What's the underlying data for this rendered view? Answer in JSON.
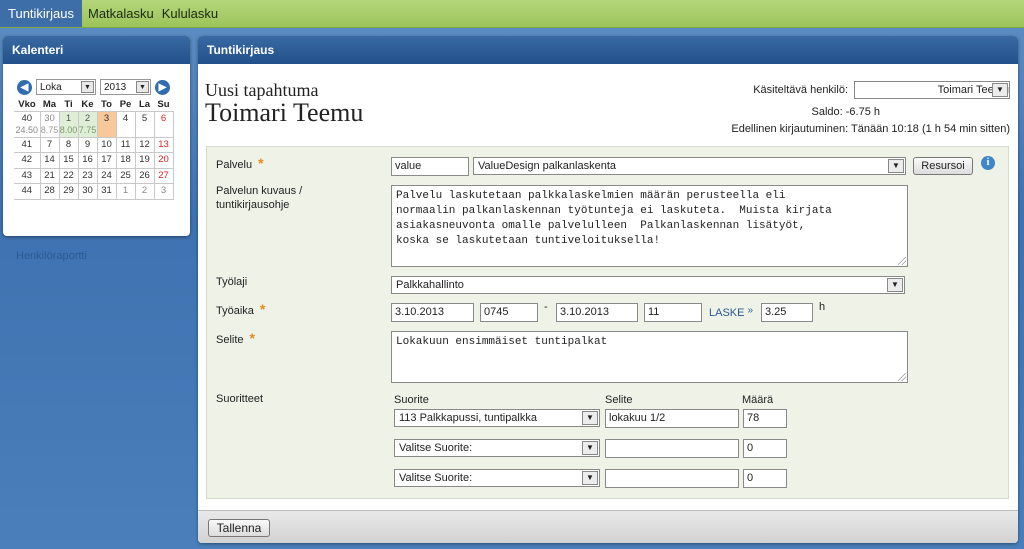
{
  "topnav": {
    "tabs": [
      {
        "label": "Tuntikirjaus",
        "active": true
      },
      {
        "label": "Matkalasku",
        "active": false
      },
      {
        "label": "Kululasku",
        "active": false
      }
    ]
  },
  "calendar": {
    "title": "Kalenteri",
    "month": "Loka",
    "year": "2013",
    "headers": [
      "Vko",
      "Ma",
      "Ti",
      "Ke",
      "To",
      "Pe",
      "La",
      "Su"
    ],
    "weeks": [
      {
        "wk": "40",
        "wk_sub": "24.50",
        "days": [
          {
            "d": "30",
            "sub": "8.75",
            "cls": "grey"
          },
          {
            "d": "1",
            "sub": "8.00",
            "cls": "green"
          },
          {
            "d": "2",
            "sub": "7.75",
            "cls": "green"
          },
          {
            "d": "3",
            "sub": "",
            "cls": "orange"
          },
          {
            "d": "4",
            "sub": "",
            "cls": ""
          },
          {
            "d": "5",
            "sub": "",
            "cls": ""
          },
          {
            "d": "6",
            "sub": "",
            "cls": "sun"
          }
        ]
      },
      {
        "wk": "41",
        "days": [
          {
            "d": "7"
          },
          {
            "d": "8"
          },
          {
            "d": "9"
          },
          {
            "d": "10"
          },
          {
            "d": "11"
          },
          {
            "d": "12"
          },
          {
            "d": "13",
            "cls": "sun"
          }
        ]
      },
      {
        "wk": "42",
        "days": [
          {
            "d": "14"
          },
          {
            "d": "15"
          },
          {
            "d": "16"
          },
          {
            "d": "17"
          },
          {
            "d": "18"
          },
          {
            "d": "19"
          },
          {
            "d": "20",
            "cls": "sun"
          }
        ]
      },
      {
        "wk": "43",
        "days": [
          {
            "d": "21"
          },
          {
            "d": "22"
          },
          {
            "d": "23"
          },
          {
            "d": "24"
          },
          {
            "d": "25"
          },
          {
            "d": "26"
          },
          {
            "d": "27",
            "cls": "sun"
          }
        ]
      },
      {
        "wk": "44",
        "days": [
          {
            "d": "28"
          },
          {
            "d": "29"
          },
          {
            "d": "30"
          },
          {
            "d": "31"
          },
          {
            "d": "1",
            "cls": "grey"
          },
          {
            "d": "2",
            "cls": "grey sun"
          },
          {
            "d": "3",
            "cls": "grey sun"
          }
        ]
      }
    ],
    "report_link": "Henkilöraportti"
  },
  "main": {
    "title": "Tuntikirjaus",
    "heading_small": "Uusi tapahtuma",
    "heading_large": "Toimari Teemu",
    "person_label": "Käsiteltävä henkilö:",
    "person_value": "Toimari Teemu",
    "saldo": "Saldo: -6.75 h",
    "last_login": "Edellinen kirjautuminen: Tänään 10:18 (1 h 54 min sitten)"
  },
  "form": {
    "palvelu_label": "Palvelu",
    "palvelu_code": "value",
    "palvelu_value": "ValueDesign palkanlaskenta",
    "resursoi_button": "Resursoi",
    "info_icon": "i",
    "kuvaus_label": "Palvelun kuvaus / tuntikirjausohje",
    "kuvaus_text": "Palvelu laskutetaan palkkalaskelmien määrän perusteella eli\nnormaalin palkanlaskennan työtunteja ei laskuteta.  Muista kirjata\nasiakasneuvonta omalle palvelulleen  Palkanlaskennan lisätyöt,\nkoska se laskutetaan tuntiveloituksella!",
    "tyolaji_label": "Työlaji",
    "tyolaji_value": "Palkkahallinto",
    "tyoaika_label": "Työaika",
    "start_date": "3.10.2013",
    "start_time": "0745",
    "dash": "-",
    "end_date": "3.10.2013",
    "end_time": "11",
    "laske_link": "LASKE",
    "laske_arrow": "»",
    "hours": "3.25",
    "hours_unit": "h",
    "selite_label": "Selite",
    "selite_text": "Lokakuun ensimmäiset tuntipalkat",
    "suoritteet_label": "Suoritteet",
    "col_suorite": "Suorite",
    "col_selite": "Selite",
    "col_maara": "Määrä",
    "rows": [
      {
        "suorite": "113 Palkkapussi, tuntipalkka",
        "selite": "lokakuu 1/2",
        "maara": "78"
      },
      {
        "suorite": "Valitse Suorite:",
        "selite": "",
        "maara": "0"
      },
      {
        "suorite": "Valitse Suorite:",
        "selite": "",
        "maara": "0"
      }
    ]
  },
  "footer": {
    "save_button": "Tallenna"
  }
}
